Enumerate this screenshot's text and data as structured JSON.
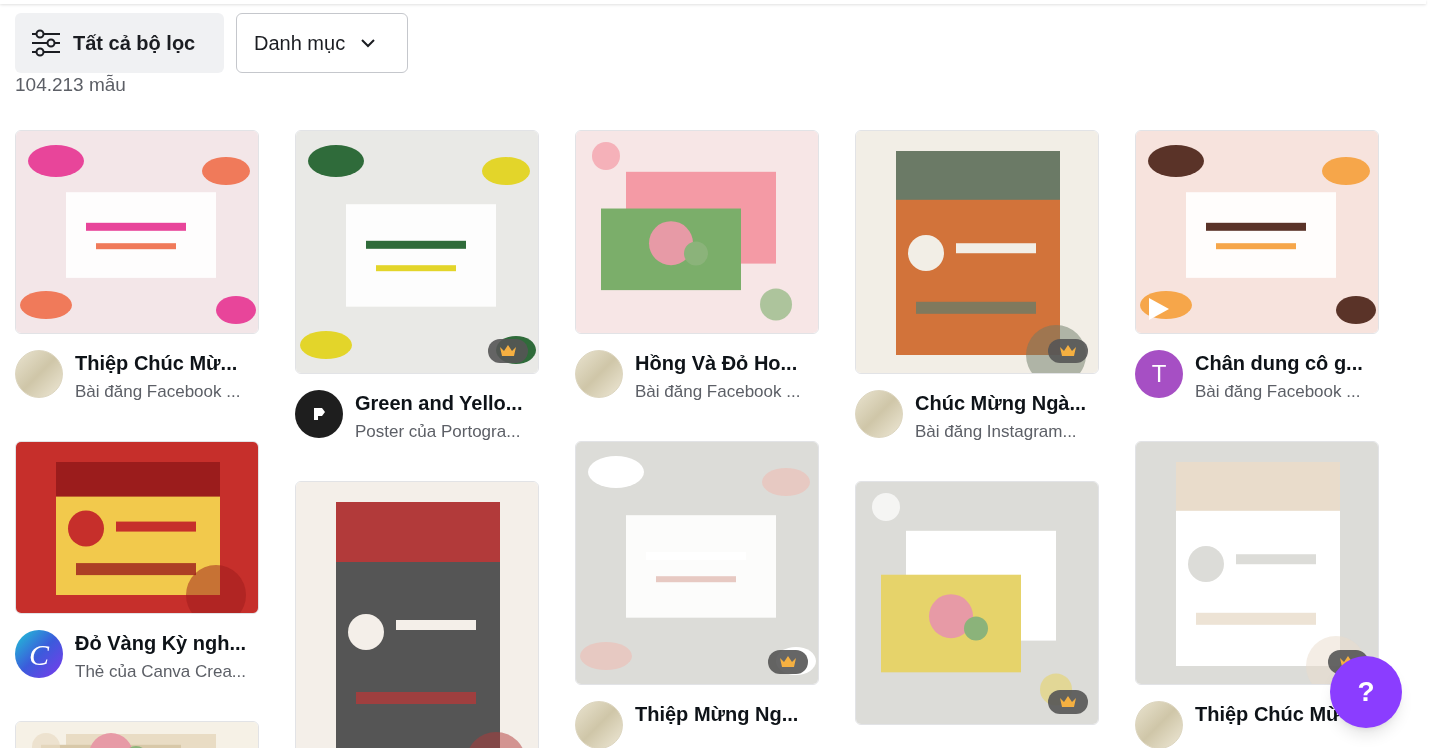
{
  "filters": {
    "all_filters": "Tất cả bộ lọc",
    "category": "Danh mục"
  },
  "result_count": "104.213 mẫu",
  "columns": [
    {
      "cards": [
        {
          "title": "Thiệp Chúc Mừ...",
          "subtitle": "Bài đăng Facebook ...",
          "premium": false,
          "video": false,
          "avatar": {
            "kind": "logo"
          }
        },
        {
          "title": "Đỏ Vàng Kỳ ngh...",
          "subtitle": "Thẻ của Canva Crea...",
          "premium": false,
          "video": false,
          "avatar": {
            "kind": "gradient",
            "letter": "C"
          }
        },
        {
          "premium": false,
          "video": false
        }
      ]
    },
    {
      "cards": [
        {
          "title": "Green and Yello...",
          "subtitle": "Poster của Portogra...",
          "premium": true,
          "video": false,
          "avatar": {
            "kind": "dark"
          }
        },
        {
          "premium": false,
          "video": false
        }
      ]
    },
    {
      "cards": [
        {
          "title": "Hồng Và Đỏ Ho...",
          "subtitle": "Bài đăng Facebook ...",
          "premium": false,
          "video": false,
          "avatar": {
            "kind": "logo"
          }
        },
        {
          "title": "Thiệp Mừng Ng...",
          "premium": true,
          "video": false,
          "avatar": {
            "kind": "logo"
          }
        }
      ]
    },
    {
      "cards": [
        {
          "title": "Chúc Mừng Ngà...",
          "subtitle": "Bài đăng Instagram...",
          "premium": true,
          "video": false,
          "avatar": {
            "kind": "logo"
          }
        },
        {
          "premium": true,
          "video": false
        }
      ]
    },
    {
      "cards": [
        {
          "title": "Chân dung cô g...",
          "subtitle": "Bài đăng Facebook ...",
          "premium": false,
          "video": true,
          "avatar": {
            "kind": "letter",
            "letter": "T",
            "color": "#a64fc4"
          }
        },
        {
          "title": "Thiệp Chúc Mừ",
          "premium": true,
          "video": false,
          "avatar": {
            "kind": "logo"
          }
        }
      ]
    }
  ],
  "help_button": "?"
}
